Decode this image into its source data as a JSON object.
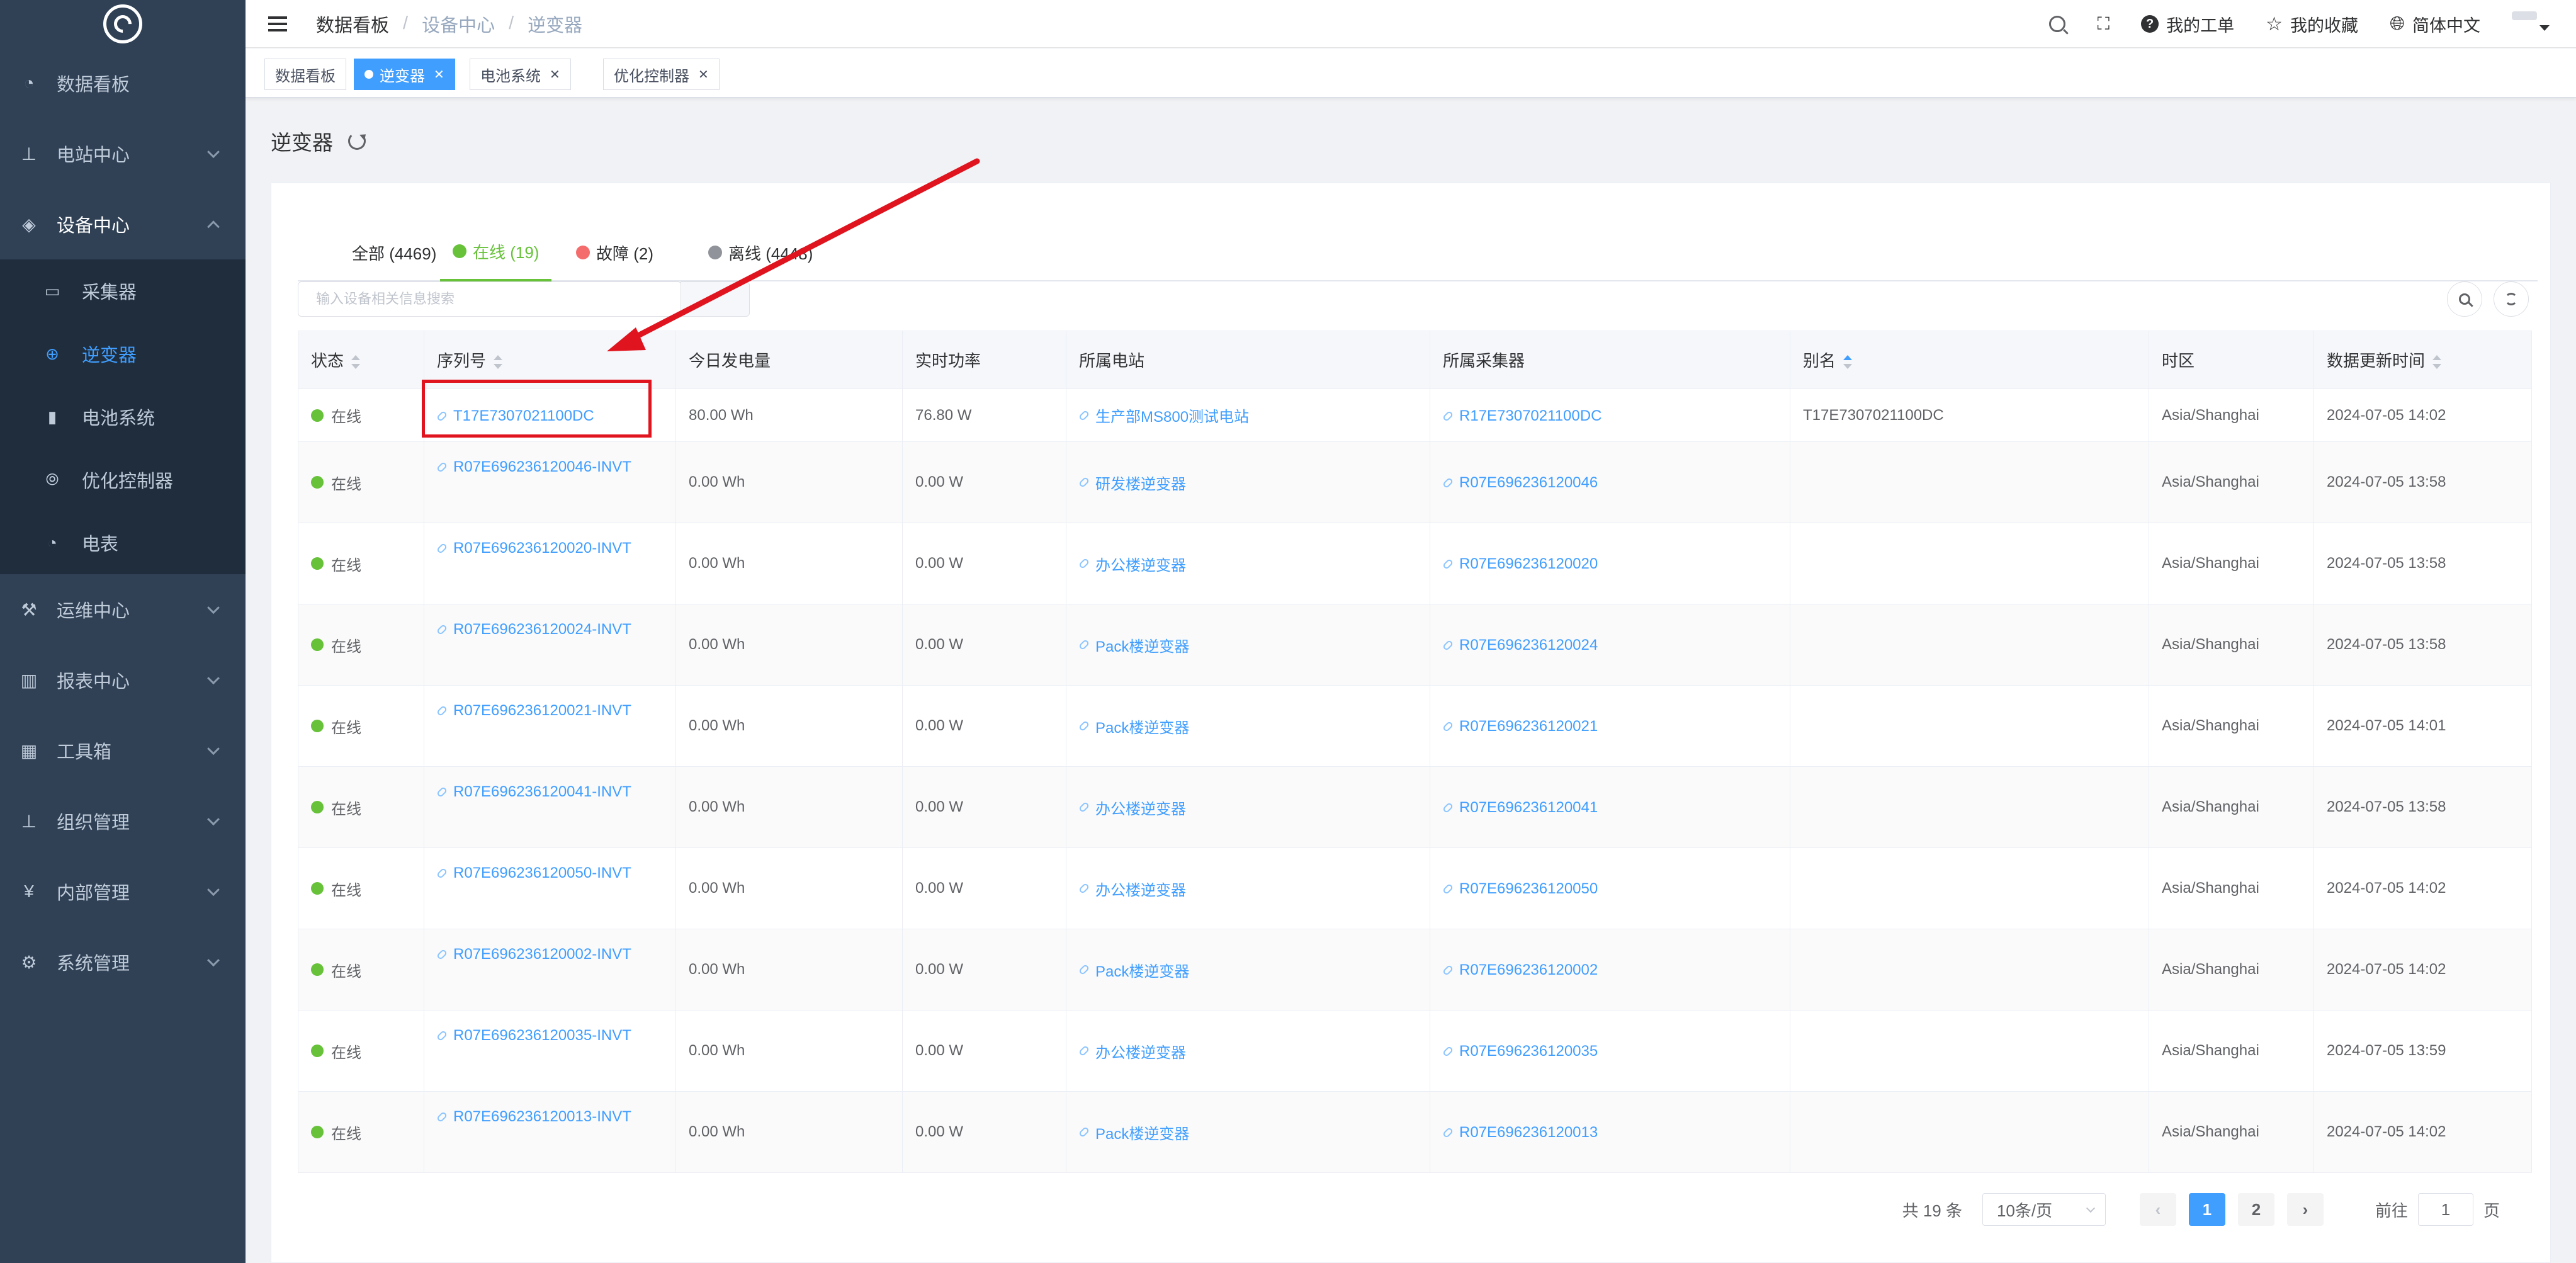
{
  "sidebar": {
    "items": [
      {
        "label": "数据看板",
        "icon": "dashboard-icon"
      },
      {
        "label": "电站中心",
        "icon": "sitemap-icon"
      },
      {
        "label": "设备中心",
        "icon": "layers-icon"
      },
      {
        "label": "运维中心",
        "icon": "tools-icon"
      },
      {
        "label": "报表中心",
        "icon": "bar-chart-icon"
      },
      {
        "label": "工具箱",
        "icon": "grid-icon"
      },
      {
        "label": "组织管理",
        "icon": "org-icon"
      },
      {
        "label": "内部管理",
        "icon": "yen-icon"
      },
      {
        "label": "系统管理",
        "icon": "gear-icon"
      }
    ],
    "sub_items": [
      {
        "label": "采集器",
        "icon": "monitor-icon"
      },
      {
        "label": "逆变器",
        "icon": "inverter-icon"
      },
      {
        "label": "电池系统",
        "icon": "battery-icon"
      },
      {
        "label": "优化控制器",
        "icon": "optimizer-icon"
      },
      {
        "label": "电表",
        "icon": "meter-icon"
      }
    ]
  },
  "topbar": {
    "breadcrumb": [
      "数据看板",
      "设备中心",
      "逆变器"
    ],
    "my_tickets": "我的工单",
    "my_favorites": "我的收藏",
    "language": "简体中文"
  },
  "tags": [
    {
      "label": "数据看板"
    },
    {
      "label": "逆变器"
    },
    {
      "label": "电池系统"
    },
    {
      "label": "优化控制器"
    }
  ],
  "page": {
    "title": "逆变器"
  },
  "tabs": [
    {
      "label": "全部 (4469)"
    },
    {
      "label": "在线 (19)",
      "color": "#67c23a"
    },
    {
      "label": "故障 (2)",
      "color": "#f56c6c"
    },
    {
      "label": "离线 (4448)",
      "color": "#909399"
    }
  ],
  "search": {
    "placeholder": "输入设备相关信息搜索"
  },
  "table": {
    "columns": [
      "状态",
      "序列号",
      "今日发电量",
      "实时功率",
      "所属电站",
      "所属采集器",
      "别名",
      "时区",
      "数据更新时间"
    ],
    "rows": [
      {
        "status": "在线",
        "serial": "T17E7307021100DC",
        "energy": "80.00 Wh",
        "power": "76.80 W",
        "station": "生产部MS800测试电站",
        "collector": "R17E7307021100DC",
        "alias": "T17E7307021100DC",
        "tz": "Asia/Shanghai",
        "updated": "2024-07-05 14:02"
      },
      {
        "status": "在线",
        "serial": "R07E696236120046-INVT",
        "energy": "0.00 Wh",
        "power": "0.00 W",
        "station": "研发楼逆变器",
        "collector": "R07E696236120046",
        "alias": "",
        "tz": "Asia/Shanghai",
        "updated": "2024-07-05 13:58"
      },
      {
        "status": "在线",
        "serial": "R07E696236120020-INVT",
        "energy": "0.00 Wh",
        "power": "0.00 W",
        "station": "办公楼逆变器",
        "collector": "R07E696236120020",
        "alias": "",
        "tz": "Asia/Shanghai",
        "updated": "2024-07-05 13:58"
      },
      {
        "status": "在线",
        "serial": "R07E696236120024-INVT",
        "energy": "0.00 Wh",
        "power": "0.00 W",
        "station": "Pack楼逆变器",
        "collector": "R07E696236120024",
        "alias": "",
        "tz": "Asia/Shanghai",
        "updated": "2024-07-05 13:58"
      },
      {
        "status": "在线",
        "serial": "R07E696236120021-INVT",
        "energy": "0.00 Wh",
        "power": "0.00 W",
        "station": "Pack楼逆变器",
        "collector": "R07E696236120021",
        "alias": "",
        "tz": "Asia/Shanghai",
        "updated": "2024-07-05 14:01"
      },
      {
        "status": "在线",
        "serial": "R07E696236120041-INVT",
        "energy": "0.00 Wh",
        "power": "0.00 W",
        "station": "办公楼逆变器",
        "collector": "R07E696236120041",
        "alias": "",
        "tz": "Asia/Shanghai",
        "updated": "2024-07-05 13:58"
      },
      {
        "status": "在线",
        "serial": "R07E696236120050-INVT",
        "energy": "0.00 Wh",
        "power": "0.00 W",
        "station": "办公楼逆变器",
        "collector": "R07E696236120050",
        "alias": "",
        "tz": "Asia/Shanghai",
        "updated": "2024-07-05 14:02"
      },
      {
        "status": "在线",
        "serial": "R07E696236120002-INVT",
        "energy": "0.00 Wh",
        "power": "0.00 W",
        "station": "Pack楼逆变器",
        "collector": "R07E696236120002",
        "alias": "",
        "tz": "Asia/Shanghai",
        "updated": "2024-07-05 14:02"
      },
      {
        "status": "在线",
        "serial": "R07E696236120035-INVT",
        "energy": "0.00 Wh",
        "power": "0.00 W",
        "station": "办公楼逆变器",
        "collector": "R07E696236120035",
        "alias": "",
        "tz": "Asia/Shanghai",
        "updated": "2024-07-05 13:59"
      },
      {
        "status": "在线",
        "serial": "R07E696236120013-INVT",
        "energy": "0.00 Wh",
        "power": "0.00 W",
        "station": "Pack楼逆变器",
        "collector": "R07E696236120013",
        "alias": "",
        "tz": "Asia/Shanghai",
        "updated": "2024-07-05 14:02"
      }
    ]
  },
  "pagination": {
    "total": "共 19 条",
    "page_size": "10条/页",
    "pages": [
      "1",
      "2"
    ],
    "current": "1",
    "goto_prefix": "前往",
    "goto_value": "1",
    "goto_suffix": "页"
  },
  "annotation": {
    "color": "#e0141e"
  },
  "colors": {
    "sidebar": "#304156",
    "accent": "#409eff",
    "online": "#67c23a"
  }
}
